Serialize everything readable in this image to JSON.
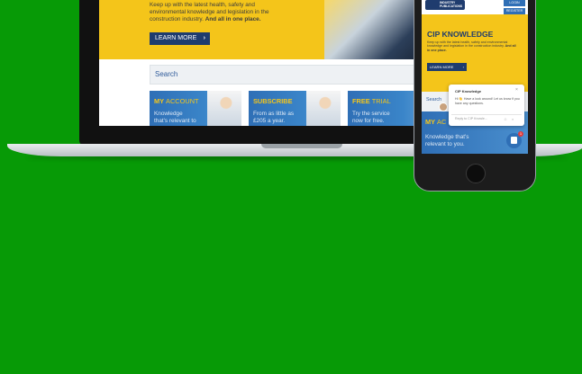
{
  "laptop": {
    "hero": {
      "text_lead": "Keep up with the latest health, safety and environmental knowledge and legislation in the construction industry.",
      "text_bold": "And all in one place.",
      "learn_more": "LEARN MORE"
    },
    "search": {
      "label": "Search"
    },
    "cards": [
      {
        "title_a": "MY",
        "title_b": "ACCOUNT",
        "body": "Knowledge that's relevant to you."
      },
      {
        "title_a": "SUBSCRIBE",
        "title_b": "",
        "body": "From as little as £205 a year."
      },
      {
        "title_a": "FREE",
        "title_b": "TRIAL",
        "body": "Try the service now for free."
      }
    ]
  },
  "phone": {
    "logo_text": "INDUSTRY PUBLICATIONS",
    "header_buttons": [
      "LOGIN",
      "REGISTER"
    ],
    "title": "CIP KNOWLEDGE",
    "text_lead": "Keep up with the latest health, safety and environmental knowledge and legislation in the construction industry.",
    "text_bold": "And all in one place.",
    "learn_more": "LEARN MORE",
    "search_label": "Search",
    "card": {
      "title_a": "MY",
      "title_b": "AC",
      "body_1": "Knowledge that's",
      "body_2": "relevant to you."
    },
    "chat": {
      "title": "CIP Knowledge",
      "message": "Hi 👋 Have a look around! Let us know if you have any questions.",
      "reply_placeholder": "Reply to CIP Knowle...",
      "badge": "1"
    }
  },
  "colors": {
    "background": "#079a06",
    "brand_yellow": "#f4c51a",
    "brand_navy": "#1f3c6e",
    "brand_blue": "#2f6fb6"
  }
}
